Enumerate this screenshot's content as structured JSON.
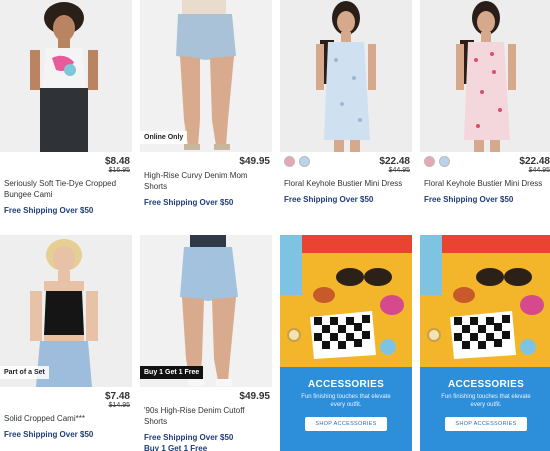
{
  "products": [
    {
      "name": "Seriously Soft Tie-Dye Cropped Bungee Cami",
      "price": "$8.48",
      "original_price": "$16.95",
      "shipping": "Free Shipping Over $50",
      "badge": "",
      "swatches": []
    },
    {
      "name": "High-Rise Curvy Denim Mom Shorts",
      "price": "$49.95",
      "original_price": "",
      "shipping": "Free Shipping Over $50",
      "badge": "Online Only",
      "swatches": []
    },
    {
      "name": "Floral Keyhole Bustier Mini Dress",
      "price": "$22.48",
      "original_price": "$44.95",
      "shipping": "Free Shipping Over $50",
      "badge": "",
      "swatches": [
        "#e7a7b6",
        "#b9d3ea"
      ]
    },
    {
      "name": "Floral Keyhole Bustier Mini Dress",
      "price": "$22.48",
      "original_price": "$44.95",
      "shipping": "Free Shipping Over $50",
      "badge": "",
      "swatches": [
        "#e7a7b6",
        "#b9d3ea"
      ]
    },
    {
      "name": "Solid Cropped Cami***",
      "price": "$7.48",
      "original_price": "$14.95",
      "shipping": "Free Shipping Over $50",
      "badge": "Part of a Set",
      "swatches": []
    },
    {
      "name": "'90s High-Rise Denim Cutoff Shorts",
      "price": "$49.95",
      "original_price": "",
      "shipping": "Free Shipping Over $50",
      "shipping_extra": "Buy 1 Get 1 Free",
      "badge": "Buy 1 Get 1 Free",
      "swatches": []
    }
  ],
  "promo": {
    "title": "ACCESSORIES",
    "subtitle": "Fun finishing touches that elevate every outfit.",
    "button": "SHOP ACCESSORIES",
    "colors": {
      "top": "#f3b62b",
      "bottom": "#2d8fd9"
    }
  }
}
